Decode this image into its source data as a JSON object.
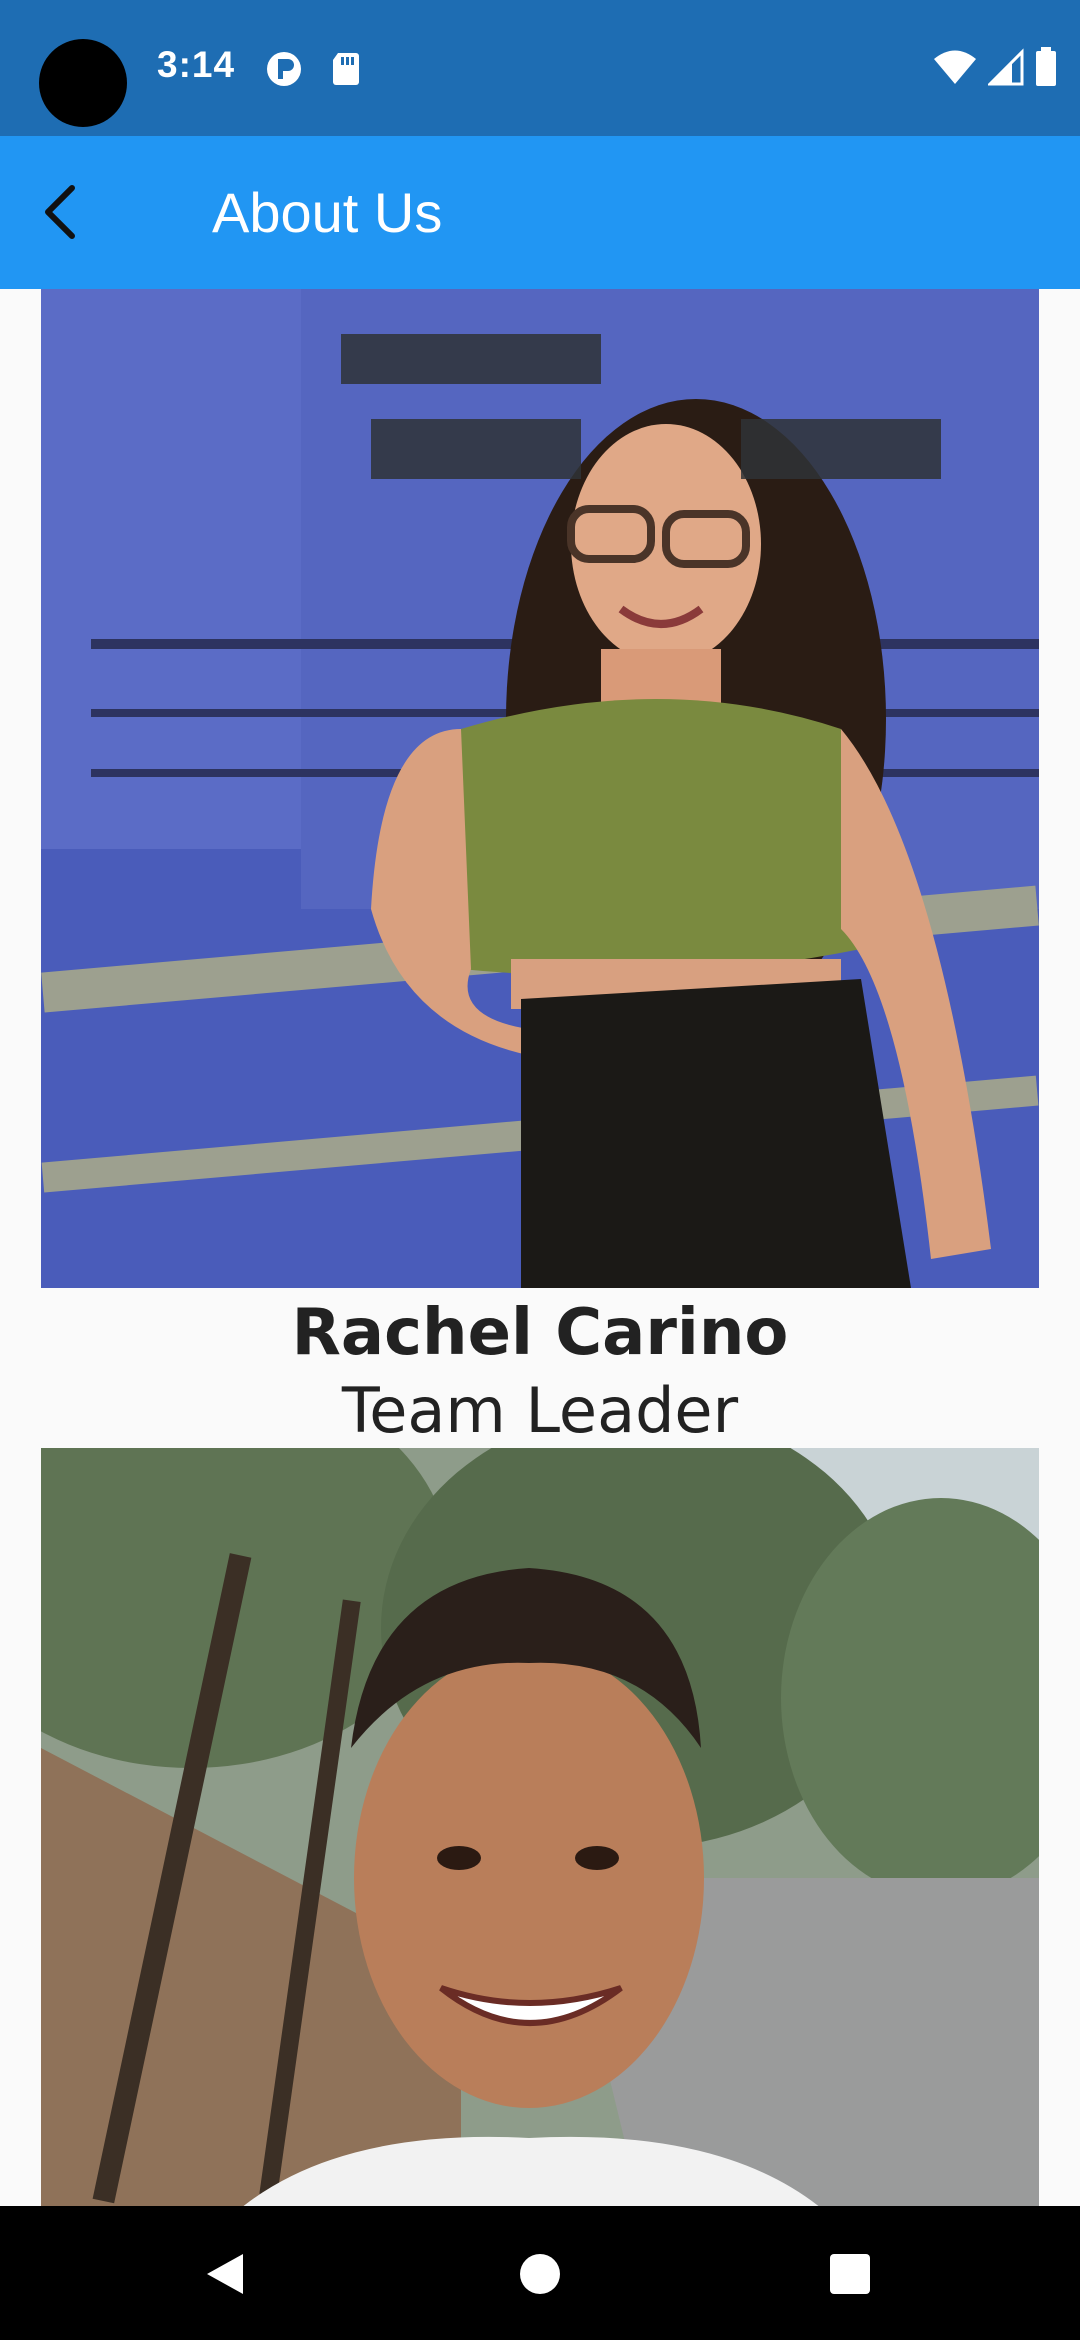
{
  "status_bar": {
    "time": "3:14",
    "icons": [
      "notification-icon",
      "sd-card-icon",
      "wifi-icon",
      "signal-icon",
      "battery-icon"
    ]
  },
  "app_bar": {
    "title": "About Us",
    "back_icon": "back-arrow-icon"
  },
  "members": [
    {
      "name": "Rachel Carino",
      "role": "Team Leader",
      "photo": "portrait photo"
    },
    {
      "name": "",
      "role": "",
      "photo": "portrait photo"
    }
  ],
  "nav_bar": {
    "buttons": [
      "back-nav-icon",
      "home-nav-icon",
      "recents-nav-icon"
    ]
  },
  "colors": {
    "status_bar": "#1e6db3",
    "app_bar": "#2196f3",
    "background": "#fafafa",
    "nav_bar": "#000000"
  }
}
